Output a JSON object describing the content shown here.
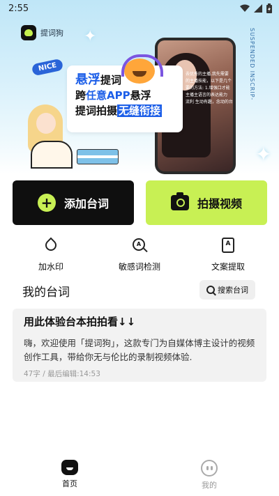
{
  "status_bar": {
    "time": "2:55"
  },
  "banner": {
    "brand_name": "提词狗",
    "badge": "NICE",
    "line1_main": "悬浮",
    "line1_sub": "提词",
    "line2_a": "跨",
    "line2_b": "任意APP",
    "line2_c": "悬浮",
    "line3_a": "提词拍摄",
    "line3_b": "无缝衔接",
    "vertical_tag": "SUSPENDED INSCRIP-",
    "phone_overlay_text": "去优秀的主播,我先需要\n的主播技能，以下是几个\n要的方法: 1.增强口才能\n主播主语言的表达能力\n流利 生动有趣，念动的台"
  },
  "actions": {
    "add_script": "添加台词",
    "shoot_video": "拍摄视频"
  },
  "tools": [
    {
      "label": "加水印"
    },
    {
      "label": "敏感词检测"
    },
    {
      "label": "文案提取"
    }
  ],
  "my_scripts": {
    "title": "我的台词",
    "search_label": "搜索台词",
    "items": [
      {
        "title": "用此体验台本拍拍看↓↓",
        "body": "嗨，欢迎使用「提词狗」，这款专门为自媒体博主设计的视频创作工具，带给你无与伦比的录制视频体验.",
        "meta": "47字 / 最后编辑:14:53"
      }
    ]
  },
  "bottom_nav": {
    "home": "首页",
    "me": "我的"
  },
  "colors": {
    "accent_green": "#c8f054",
    "brand_blue": "#1d5fe8",
    "dark": "#0f0f0f"
  }
}
